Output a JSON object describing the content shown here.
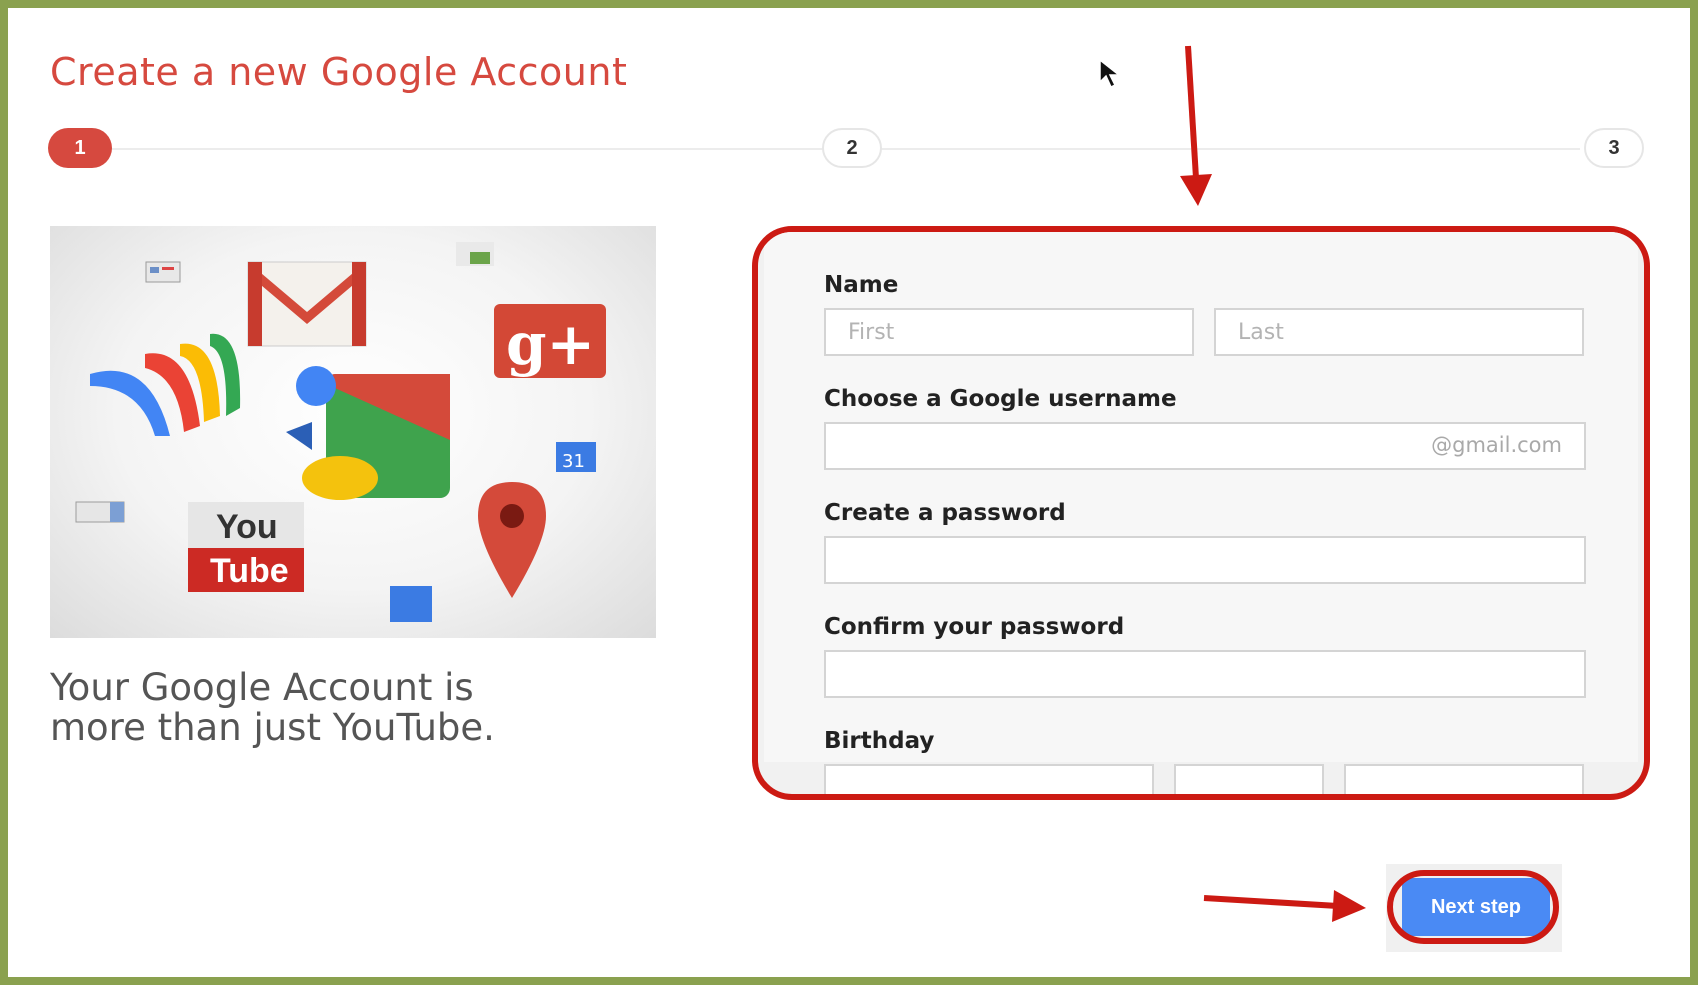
{
  "page": {
    "title": "Create a new Google Account",
    "steps": [
      "1",
      "2",
      "3"
    ]
  },
  "promo": {
    "line1": "Your Google Account is",
    "line2": "more than just YouTube.",
    "youtube_top": "You",
    "youtube_bottom": "Tube",
    "calendar_day": "31"
  },
  "form": {
    "name_label": "Name",
    "first_placeholder": "First",
    "last_placeholder": "Last",
    "username_label": "Choose a Google username",
    "username_suffix": "@gmail.com",
    "password_label": "Create a password",
    "confirm_label": "Confirm your password",
    "birthday_label": "Birthday"
  },
  "actions": {
    "next_label": "Next step"
  },
  "colors": {
    "frame": "#8aa14f",
    "title": "#d6493f",
    "annotation": "#cc1a13",
    "button": "#4a8af4"
  }
}
